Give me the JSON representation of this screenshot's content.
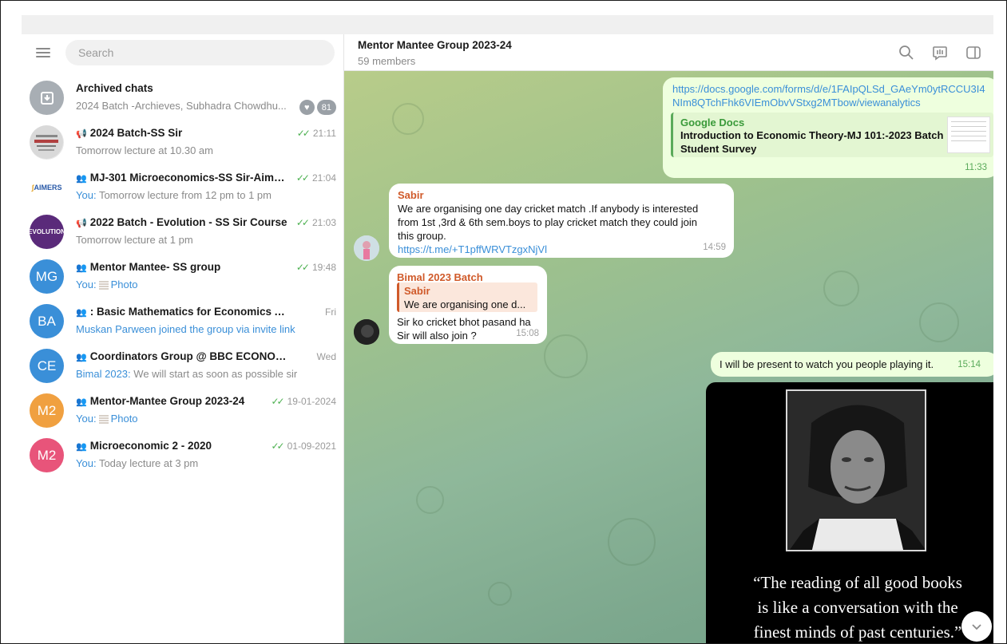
{
  "search": {
    "placeholder": "Search"
  },
  "chats": [
    {
      "name": "Archived chats",
      "preview": "2024 Batch -Archieves, Subhadra Chowdhu...",
      "unread": "81"
    },
    {
      "name": "2024 Batch-SS Sir",
      "preview": "Tomorrow lecture at 10.30 am",
      "time": "21:11",
      "prefix": ""
    },
    {
      "name": "MJ-301 Microeconomics-SS Sir-Aimers ...",
      "preview": "Tomorrow lecture from 12 pm to 1 pm",
      "time": "21:04",
      "prefix": "You:",
      "avatar_text": "AIMERS"
    },
    {
      "name": "2022 Batch - Evolution - SS Sir Course",
      "preview": "Tomorrow lecture at 1 pm",
      "time": "21:03",
      "avatar_text": "EVOLUTION"
    },
    {
      "name": "Mentor Mantee- SS group",
      "preview": "Photo",
      "time": "19:48",
      "prefix": "You:",
      "avatar_text": "MG",
      "avatar_color": "#3a8fd8"
    },
    {
      "name": ": Basic Mathematics for Economics Analysis",
      "preview": "Muskan Parween joined the group via invite link",
      "time": "Fri",
      "avatar_text": "BA",
      "avatar_color": "#3a8fd8"
    },
    {
      "name": "Coordinators Group @ BBC ECONOMICS",
      "preview": "We will start as soon as possible sir",
      "time": "Wed",
      "prefix": "Bimal 2023:",
      "avatar_text": "CE",
      "avatar_color": "#3a8fd8"
    },
    {
      "name": "Mentor-Mantee Group 2023-24",
      "preview": "Photo",
      "time": "19-01-2024",
      "prefix": "You:",
      "avatar_text": "M2",
      "avatar_color": "#f0a040"
    },
    {
      "name": "Microeconomic 2 - 2020",
      "preview": "Today lecture at 3 pm",
      "time": "01-09-2021",
      "prefix": "You:",
      "avatar_text": "M2",
      "avatar_color": "#e8547a"
    }
  ],
  "header": {
    "title": "Mentor Mantee Group 2023-24",
    "subtitle": "59 members"
  },
  "messages": {
    "m1": {
      "link": "https://docs.google.com/forms/d/e/1FAIpQLSd_GAeYm0ytRCCU3I4NIm8QTchFhk6VIEmObvVStxg2MTbow/viewanalytics",
      "link_line1": "https://docs.google.com/forms/d/e/1FAIpQLSd_GAeYm0ytRCCU3I4",
      "link_line2": "NIm8QTchFhk6VIEmObvVStxg2MTbow/viewanalytics",
      "preview_source": "Google Docs",
      "preview_title": "Introduction to Economic Theory-MJ 101:-2023 Batch Student Survey",
      "time": "11:33"
    },
    "m2": {
      "sender": "Sabir",
      "sender_color": "#d05a2a",
      "line1": "We are organising one day cricket match .If anybody is interested",
      "line2": "from 1st ,3rd & 6th sem.boys  to play cricket match they could  join",
      "line3": "this group.",
      "link": "https://t.me/+T1pffWRVTzgxNjVl",
      "time": "14:59"
    },
    "m3": {
      "sender": "Bimal 2023 Batch",
      "reply_name": "Sabir",
      "reply_text": "We are organising one d...",
      "line1": "Sir ko cricket bhot pasand ha",
      "line2": "Sir will also join ?",
      "time": "15:08"
    },
    "m4": {
      "text": "I will be present to watch you people playing it.",
      "time": "15:14"
    },
    "m5": {
      "quote1": "“The reading of all good books",
      "quote2": "is like a conversation with the",
      "quote3": "finest minds of past centuries.”"
    }
  },
  "colors": {
    "accent": "#3a8fd8",
    "check": "#4cb050",
    "bubble_out": "#eeffde",
    "sender_red": "#d05a2a"
  }
}
